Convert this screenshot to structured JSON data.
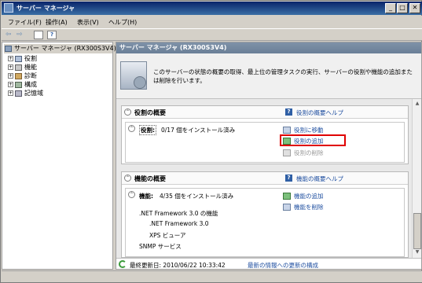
{
  "window": {
    "title": "サーバー マネージャ",
    "buttons": {
      "minimize": "_",
      "maximize": "□",
      "close": "✕"
    }
  },
  "menu": [
    "ファイル(F)",
    "操作(A)",
    "表示(V)",
    "ヘルプ(H)"
  ],
  "toolbar": {
    "back": "⇦",
    "forward": "⇨",
    "help": "?"
  },
  "tree": {
    "root": "サーバー マネージャ (RX300S3V4)",
    "items": [
      "役割",
      "機能",
      "診断",
      "構成",
      "記憶域"
    ]
  },
  "pane": {
    "header": "サーバー マネージャ (RX300S3V4)",
    "description": "このサーバーの状態の概要の取得、最上位の管理タスクの実行、サーバーの役割や機能の追加または削除を行います。"
  },
  "roles": {
    "title": "役割の概要",
    "help": "役割の概要ヘルプ",
    "label": "役割:",
    "status": "0/17 個をインストール済み",
    "actions": [
      "役割に移動",
      "役割の追加",
      "役割の削除"
    ]
  },
  "features": {
    "title": "機能の概要",
    "help": "機能の概要ヘルプ",
    "label": "機能:",
    "status": "4/35 個をインストール済み",
    "actions": [
      "機能の追加",
      "機能を削除"
    ],
    "installed": [
      ".NET Framework 3.0 の機能",
      ".NET Framework 3.0",
      "XPS ビューア",
      "SNMP サービス"
    ]
  },
  "status": {
    "last_update": "最終更新日: 2010/06/22 10:33:42",
    "refresh_link": "最新の情報への更新の構成"
  },
  "colors": {
    "highlight": "#e00000",
    "link": "#1f4fa0",
    "titlebar": "#0a246a"
  }
}
